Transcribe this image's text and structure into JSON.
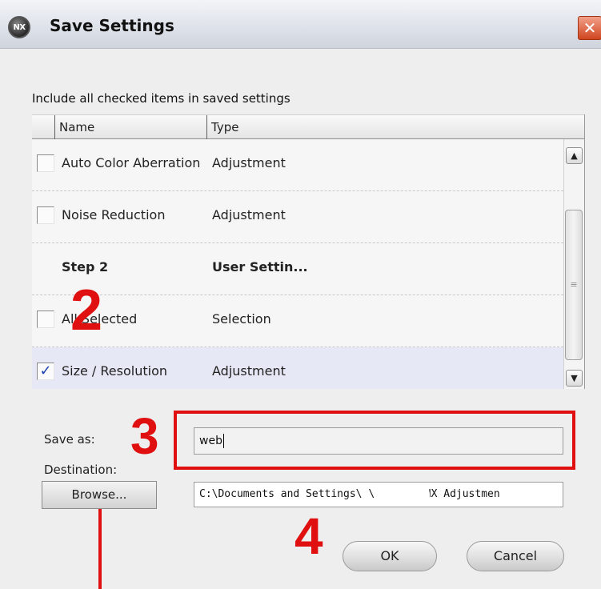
{
  "window": {
    "title": "Save Settings",
    "logo_text": "NX",
    "close_glyph": "✕"
  },
  "caption": "Include all checked items in saved settings",
  "table": {
    "columns": [
      "Name",
      "Type"
    ],
    "rows": [
      {
        "name": "Auto Color Aberration",
        "type": "Adjustment",
        "checked": false,
        "bold": false,
        "has_checkbox": true
      },
      {
        "name": "Noise Reduction",
        "type": "Adjustment",
        "checked": false,
        "bold": false,
        "has_checkbox": true
      },
      {
        "name": "Step 2",
        "type": "User Settin...",
        "checked": false,
        "bold": true,
        "has_checkbox": false
      },
      {
        "name": "All Selected",
        "type": "Selection",
        "checked": false,
        "bold": false,
        "has_checkbox": true
      },
      {
        "name": "Size / Resolution",
        "type": "Adjustment",
        "checked": true,
        "bold": false,
        "has_checkbox": true,
        "selected": true
      }
    ],
    "check_glyph": "✓"
  },
  "scrollbar": {
    "up_glyph": "▲",
    "down_glyph": "▼",
    "grip_glyph": "≡"
  },
  "form": {
    "save_as_label": "Save as:",
    "save_as_value": "web",
    "destination_label": "Destination:",
    "destination_value": "C:\\Documents and Settings\\          \\Desktop\\NX Adjustmen",
    "browse_label": "Browse...",
    "ok_label": "OK",
    "cancel_label": "Cancel"
  },
  "annotations": {
    "step_2": "2",
    "step_3": "3",
    "step_4": "4",
    "accent_color": "#e01010"
  }
}
